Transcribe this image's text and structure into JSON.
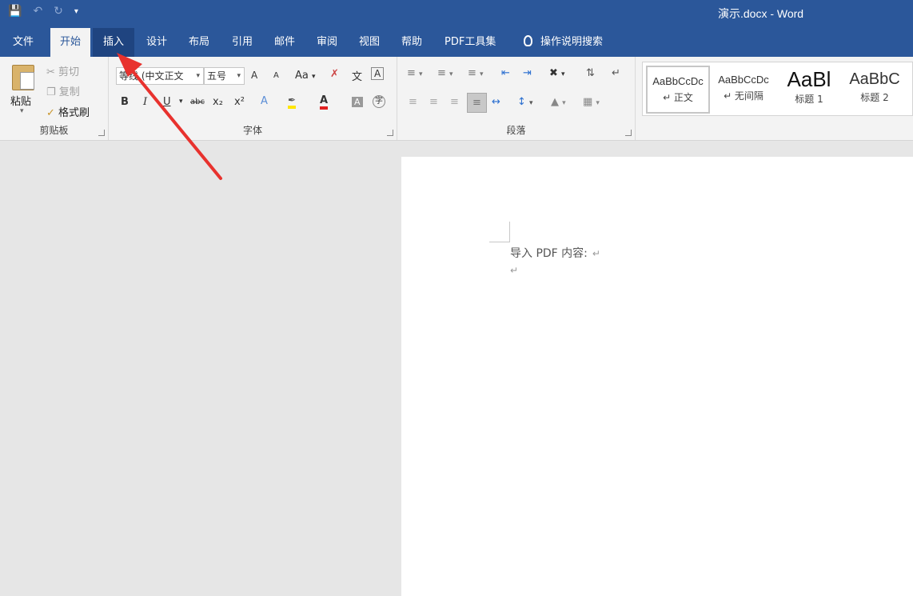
{
  "window": {
    "title": "演示.docx - Word",
    "qat": {
      "save_icon": "save-icon",
      "undo_icon": "undo-icon",
      "redo_icon": "redo-icon",
      "customize_icon": "customize-qat-icon"
    }
  },
  "tabs": [
    {
      "label": "文件"
    },
    {
      "label": "开始"
    },
    {
      "label": "插入"
    },
    {
      "label": "设计"
    },
    {
      "label": "布局"
    },
    {
      "label": "引用"
    },
    {
      "label": "邮件"
    },
    {
      "label": "审阅"
    },
    {
      "label": "视图"
    },
    {
      "label": "帮助"
    },
    {
      "label": "PDF工具集"
    }
  ],
  "tell_me": "操作说明搜索",
  "ribbon": {
    "clipboard": {
      "paste": "粘贴",
      "cut": "剪切",
      "copy": "复制",
      "format_painter": "格式刷",
      "label": "剪贴板"
    },
    "font": {
      "font_name": "等线 (中文正文",
      "font_size": "五号",
      "grow": "A",
      "shrink": "A",
      "change_case": "Aa",
      "bold": "B",
      "italic": "I",
      "underline": "U",
      "strike": "abc",
      "subscript": "x₂",
      "superscript": "x²",
      "font_color": "A",
      "label": "字体"
    },
    "paragraph": {
      "label": "段落"
    },
    "styles": [
      {
        "sample": "AaBbCcDc",
        "name": "↵ 正文"
      },
      {
        "sample": "AaBbCcDc",
        "name": "↵ 无间隔"
      },
      {
        "sample": "AaBl",
        "name": "标题 1"
      },
      {
        "sample": "AaBbC",
        "name": "标题 2"
      }
    ]
  },
  "document": {
    "line1": "导入 PDF 内容:",
    "para_mark": "↵"
  },
  "colors": {
    "brand": "#2b579a",
    "annotation_arrow": "#e8322e"
  }
}
